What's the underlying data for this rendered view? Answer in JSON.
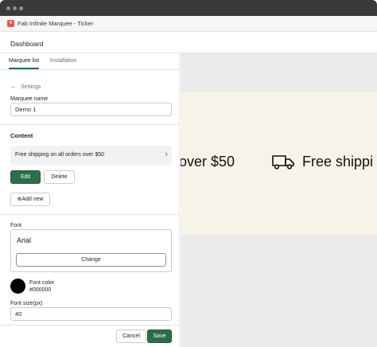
{
  "app": {
    "title": "Fab Infinite Marquee - Ticker",
    "logo": "fab-logo",
    "page_title": "Dashboard"
  },
  "tabs": [
    {
      "label": "Marquee list",
      "active": true
    },
    {
      "label": "Installation",
      "active": false
    }
  ],
  "back_link": {
    "label": "Settings",
    "icon": "arrow-left-icon"
  },
  "marquee_name": {
    "label": "Marquee name",
    "value": "Demo 1"
  },
  "content": {
    "title": "Content",
    "item": "Free shipping on all orders over $50",
    "edit_label": "Edit",
    "delete_label": "Delete",
    "add_new_label": "Add new"
  },
  "font": {
    "label": "Font",
    "value": "Arial",
    "change_label": "Change",
    "color_label": "Font color",
    "color_value": "#000000",
    "size_label": "Font size(px)",
    "size_value": "40"
  },
  "footer": {
    "cancel_label": "Cancel",
    "save_label": "Save"
  },
  "preview": {
    "text_left": "over $50",
    "text_right": "Free shippi",
    "icon": "truck-icon",
    "background": "#f6f3e8"
  },
  "colors": {
    "accent": "#2c6e49",
    "titlebar": "#3a3a3c"
  }
}
